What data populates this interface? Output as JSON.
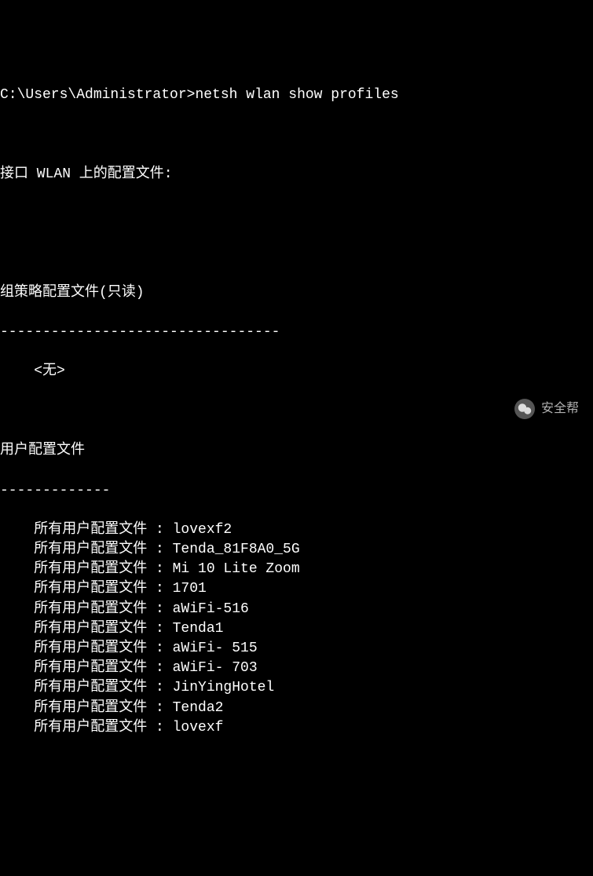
{
  "terminal": {
    "prompt": "C:\\Users\\Administrator>",
    "command": "netsh wlan show profiles",
    "header": "接口 WLAN 上的配置文件:",
    "group_policy_title": "组策略配置文件(只读)",
    "group_policy_separator": "---------------------------------",
    "group_policy_none": "    <无>",
    "user_profiles_title": "用户配置文件",
    "user_profiles_separator": "-------------",
    "profile_label": "所有用户配置文件",
    "profiles": [
      "lovexf2",
      "Tenda_81F8A0_5G",
      "Mi 10 Lite Zoom",
      "1701",
      "aWiFi-516",
      "Tenda1",
      "aWiFi- 515",
      "aWiFi- 703",
      "JinYingHotel",
      "Tenda2",
      "lovexf"
    ]
  },
  "watermark": {
    "text": "安全帮"
  }
}
